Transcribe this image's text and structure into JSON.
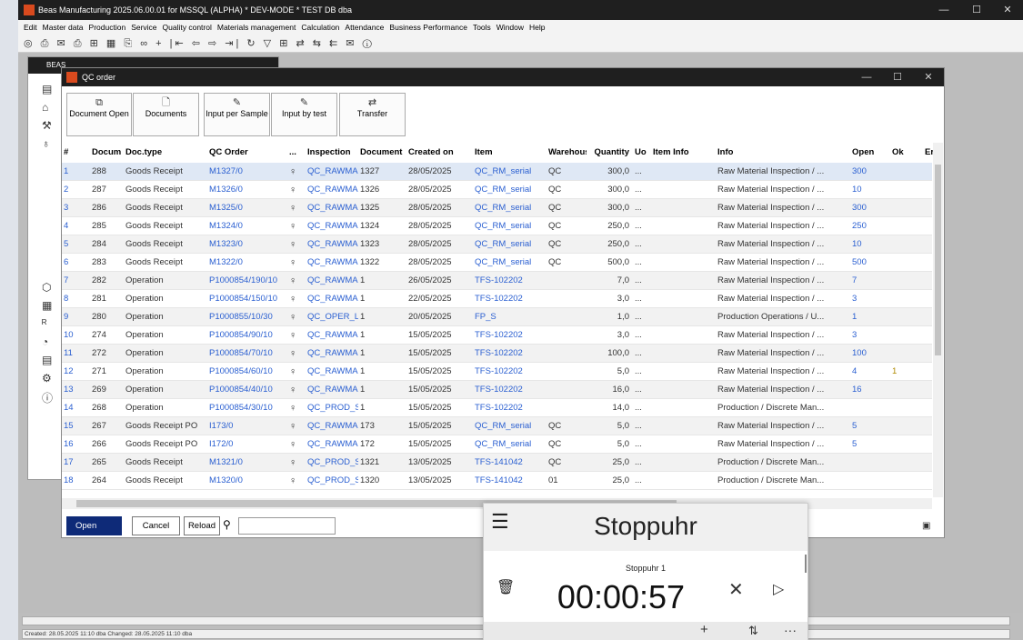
{
  "app": {
    "title": "Beas Manufacturing 2025.06.00.01 for MSSQL (ALPHA)   * DEV-MODE *  TEST DB  dba",
    "win_min": "—",
    "win_max": "☐",
    "win_close": "✕",
    "menu": [
      "Edit",
      "Master data",
      "Production",
      "Service",
      "Quality control",
      "Materials management",
      "Calculation",
      "Attendance",
      "Business Performance",
      "Tools",
      "Window",
      "Help"
    ],
    "toolbar_glyphs": "◎ ⎙ ✉ ⎙ ⊞ ▦ ⎘ ∞ + |⇤ ⇦ ⇨ ⇥| ↻ ▽ ⊞ ⇄ ⇆ ⇇ ✉ ⓘ",
    "status": "Created: 28.05.2025 11:10  dba   Changed: 28.05.2025 11:10  dba"
  },
  "bg_window": {
    "title": "BEAS"
  },
  "qc": {
    "title": "QC order",
    "win_min": "—",
    "win_max": "☐",
    "win_close": "✕",
    "toolbar": [
      {
        "icon": "⧉",
        "label": "Document Open"
      },
      {
        "icon": "🗋",
        "label": "Documents"
      },
      {
        "icon": "✎",
        "label": "Input per Sample"
      },
      {
        "icon": "✎",
        "label": "Input by test"
      },
      {
        "icon": "⇄",
        "label": "Transfer"
      }
    ],
    "columns": [
      "#",
      "Docum",
      "Doc.type",
      "QC Order",
      "...",
      "Inspection",
      "Document",
      "Created on",
      "Item",
      "Warehouse",
      "Quantity",
      "Uo",
      "Item Info",
      "Info",
      "Open",
      "Ok",
      "Er"
    ],
    "rows": [
      [
        "1",
        "288",
        "Goods Receipt",
        "M1327/0",
        "QC_RAWMA",
        "1327",
        "28/05/2025",
        "QC_RM_serial",
        "QC",
        "300,0",
        "...",
        "",
        "Raw Material Inspection / ...",
        "300",
        ""
      ],
      [
        "2",
        "287",
        "Goods Receipt",
        "M1326/0",
        "QC_RAWMA",
        "1326",
        "28/05/2025",
        "QC_RM_serial",
        "QC",
        "300,0",
        "...",
        "",
        "Raw Material Inspection / ...",
        "10",
        ""
      ],
      [
        "3",
        "286",
        "Goods Receipt",
        "M1325/0",
        "QC_RAWMA",
        "1325",
        "28/05/2025",
        "QC_RM_serial",
        "QC",
        "300,0",
        "...",
        "",
        "Raw Material Inspection / ...",
        "300",
        ""
      ],
      [
        "4",
        "285",
        "Goods Receipt",
        "M1324/0",
        "QC_RAWMA",
        "1324",
        "28/05/2025",
        "QC_RM_serial",
        "QC",
        "250,0",
        "...",
        "",
        "Raw Material Inspection / ...",
        "250",
        ""
      ],
      [
        "5",
        "284",
        "Goods Receipt",
        "M1323/0",
        "QC_RAWMA",
        "1323",
        "28/05/2025",
        "QC_RM_serial",
        "QC",
        "250,0",
        "...",
        "",
        "Raw Material Inspection / ...",
        "10",
        ""
      ],
      [
        "6",
        "283",
        "Goods Receipt",
        "M1322/0",
        "QC_RAWMA",
        "1322",
        "28/05/2025",
        "QC_RM_serial",
        "QC",
        "500,0",
        "...",
        "",
        "Raw Material Inspection / ...",
        "500",
        ""
      ],
      [
        "7",
        "282",
        "Operation",
        "P1000854/190/10",
        "QC_RAWMA",
        "1",
        "26/05/2025",
        "TFS-102202",
        "",
        "7,0",
        "...",
        "",
        "Raw Material Inspection / ...",
        "7",
        ""
      ],
      [
        "8",
        "281",
        "Operation",
        "P1000854/150/10",
        "QC_RAWMA",
        "1",
        "22/05/2025",
        "TFS-102202",
        "",
        "3,0",
        "...",
        "",
        "Raw Material Inspection / ...",
        "3",
        ""
      ],
      [
        "9",
        "280",
        "Operation",
        "P1000855/10/30",
        "QC_OPER_L",
        "1",
        "20/05/2025",
        "FP_S",
        "",
        "1,0",
        "...",
        "",
        "Production Operations / U...",
        "1",
        ""
      ],
      [
        "10",
        "274",
        "Operation",
        "P1000854/90/10",
        "QC_RAWMA",
        "1",
        "15/05/2025",
        "TFS-102202",
        "",
        "3,0",
        "...",
        "",
        "Raw Material Inspection / ...",
        "3",
        ""
      ],
      [
        "11",
        "272",
        "Operation",
        "P1000854/70/10",
        "QC_RAWMA",
        "1",
        "15/05/2025",
        "TFS-102202",
        "",
        "100,0",
        "...",
        "",
        "Raw Material Inspection / ...",
        "100",
        ""
      ],
      [
        "12",
        "271",
        "Operation",
        "P1000854/60/10",
        "QC_RAWMA",
        "1",
        "15/05/2025",
        "TFS-102202",
        "",
        "5,0",
        "...",
        "",
        "Raw Material Inspection / ...",
        "4",
        "1"
      ],
      [
        "13",
        "269",
        "Operation",
        "P1000854/40/10",
        "QC_RAWMA",
        "1",
        "15/05/2025",
        "TFS-102202",
        "",
        "16,0",
        "...",
        "",
        "Raw Material Inspection / ...",
        "16",
        ""
      ],
      [
        "14",
        "268",
        "Operation",
        "P1000854/30/10",
        "QC_PROD_S",
        "1",
        "15/05/2025",
        "TFS-102202",
        "",
        "14,0",
        "...",
        "",
        "Production / Discrete Man...",
        "",
        ""
      ],
      [
        "15",
        "267",
        "Goods Receipt PO",
        "I173/0",
        "QC_RAWMA",
        "173",
        "15/05/2025",
        "QC_RM_serial",
        "QC",
        "5,0",
        "...",
        "",
        "Raw Material Inspection / ...",
        "5",
        ""
      ],
      [
        "16",
        "266",
        "Goods Receipt PO",
        "I172/0",
        "QC_RAWMA",
        "172",
        "15/05/2025",
        "QC_RM_serial",
        "QC",
        "5,0",
        "...",
        "",
        "Raw Material Inspection / ...",
        "5",
        ""
      ],
      [
        "17",
        "265",
        "Goods Receipt",
        "M1321/0",
        "QC_PROD_S",
        "1321",
        "13/05/2025",
        "TFS-141042",
        "QC",
        "25,0",
        "...",
        "",
        "Production / Discrete Man...",
        "",
        ""
      ],
      [
        "18",
        "264",
        "Goods Receipt",
        "M1320/0",
        "QC_PROD_S",
        "1320",
        "13/05/2025",
        "TFS-141042",
        "01",
        "25,0",
        "...",
        "",
        "Production / Discrete Man...",
        "",
        ""
      ]
    ],
    "buttons": {
      "open": "Open",
      "cancel": "Cancel",
      "reload": "Reload"
    },
    "search_value": ""
  },
  "stopwatch": {
    "title": "Stoppuhr",
    "name": "Stoppuhr 1",
    "time": "00:00:57",
    "menu_icon": "☰",
    "delete_icon": "🗑",
    "reset_icon": "✕",
    "play_icon": "▷",
    "add_icon": "+",
    "sort_icon": "⇅",
    "more_icon": "···"
  }
}
